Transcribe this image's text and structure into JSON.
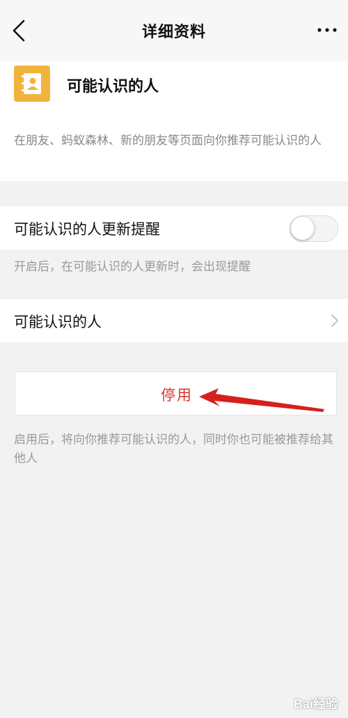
{
  "nav": {
    "title": "详细资料"
  },
  "profile": {
    "name": "可能认识的人",
    "description": "在朋友、蚂蚁森林、新的朋友等页面向你推荐可能认识的人",
    "icon": "contacts-book-icon",
    "icon_color": "#f2b33d"
  },
  "settings": {
    "update_reminder": {
      "label": "可能认识的人更新提醒",
      "enabled": false,
      "hint": "开启后，在可能认识的人更新时，会出现提醒"
    },
    "people_link": {
      "label": "可能认识的人"
    }
  },
  "action": {
    "disable_label": "停用",
    "hint": "启用后，将向你推荐可能认识的人，同时你也可能被推荐给其他人"
  },
  "watermark": {
    "text": "Bai经验"
  },
  "colors": {
    "danger": "#d9312b",
    "annotation_arrow": "#d6201c"
  }
}
